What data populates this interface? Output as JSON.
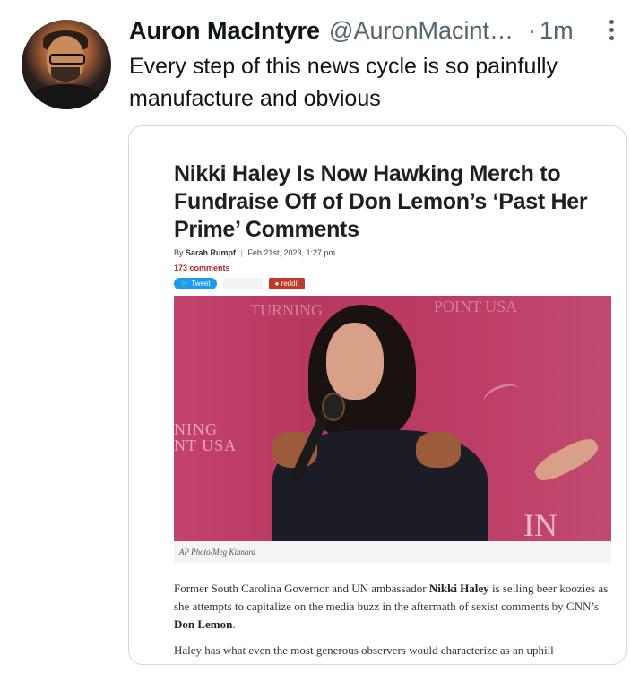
{
  "tweet": {
    "author_name": "Auron MacIntyre",
    "handle": "@AuronMacintyre",
    "dot": "·",
    "time": "1m",
    "text": "Every step of this news cycle is so painfully manufacture and obvious"
  },
  "card": {
    "headline": "Nikki Haley Is Now Hawking Merch to Fundraise Off of Don Lemon’s ‘Past Her Prime’ Comments",
    "byline_prefix": "By",
    "author": "Sarah Rumpf",
    "date": "Feb 21st, 2023, 1:27 pm",
    "comments": "173 comments",
    "share": {
      "tweet_label": "Tweet",
      "reddit_label": "reddit"
    },
    "photo_logos": {
      "left": "NING\nNT USA",
      "top1": "TURNING",
      "top2": "POINT USA",
      "right": "IN"
    },
    "photo_credit": "AP Photo/Meg Kinnard",
    "para1_part1": "Former South Carolina Governor and UN ambassador ",
    "para1_bold1": "Nikki Haley",
    "para1_part2": " is selling beer koozies as she attempts to capitalize on the media buzz in the aftermath of sexist comments by CNN’s ",
    "para1_bold2": "Don Lemon",
    "para1_end": ".",
    "para2": "Haley has what even the most generous observers would characterize as an uphill"
  }
}
